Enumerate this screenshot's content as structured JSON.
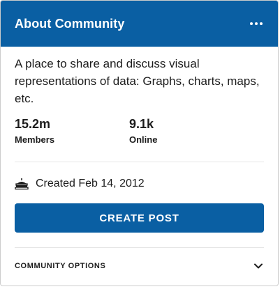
{
  "header": {
    "title": "About Community",
    "more_icon": "more-horizontal-icon"
  },
  "about": {
    "description": "A place to share and discuss visual representations of data: Graphs, charts, maps, etc."
  },
  "stats": [
    {
      "value": "15.2m",
      "label": "Members"
    },
    {
      "value": "9.1k",
      "label": "Online"
    }
  ],
  "created": {
    "icon": "cake-icon",
    "text": "Created Feb 14, 2012"
  },
  "actions": {
    "create_post_label": "CREATE POST"
  },
  "options": {
    "label": "COMMUNITY OPTIONS",
    "icon": "chevron-down-icon"
  },
  "colors": {
    "accent": "#0a5fa3",
    "text": "#1c1c1c"
  }
}
